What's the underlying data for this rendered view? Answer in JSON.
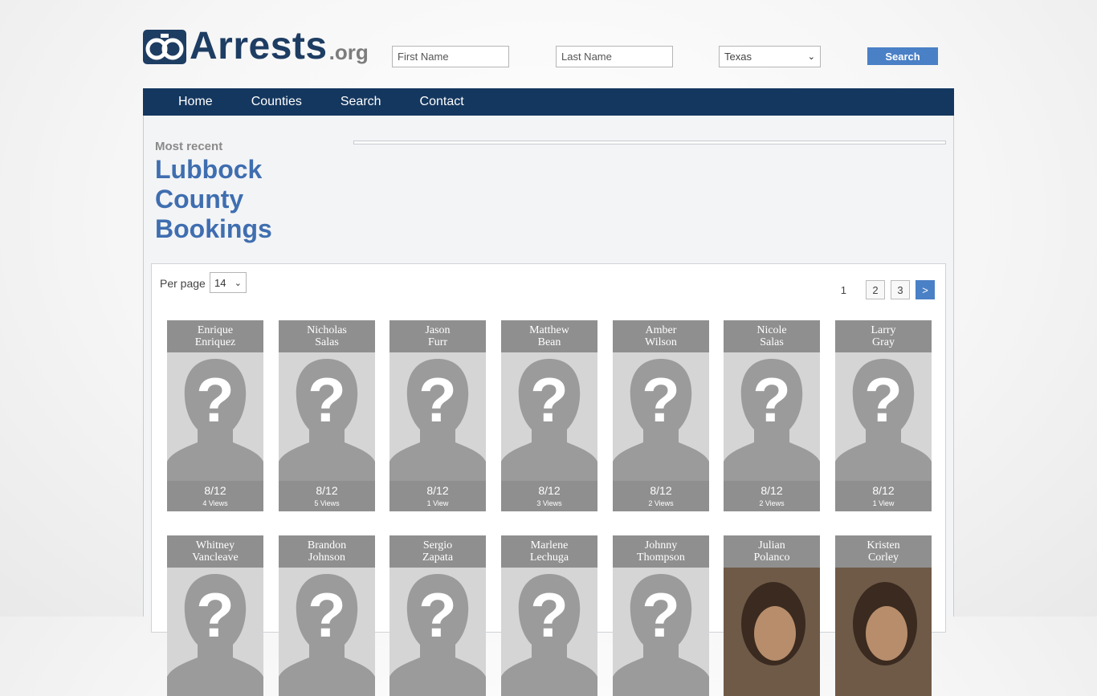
{
  "site": {
    "logo_text": "Arrests",
    "logo_suffix": ".org"
  },
  "search": {
    "first_name_placeholder": "First Name",
    "last_name_placeholder": "Last Name",
    "state_selected": "Texas",
    "button_label": "Search"
  },
  "nav": {
    "items": [
      "Home",
      "Counties",
      "Search",
      "Contact"
    ]
  },
  "page": {
    "kicker": "Most recent",
    "title": "Lubbock County Bookings"
  },
  "listing": {
    "per_page_label": "Per page",
    "per_page_value": "14",
    "pagination": {
      "current": "1",
      "pages": [
        "2",
        "3"
      ],
      "next_label": ">"
    },
    "people": [
      {
        "first": "Enrique",
        "last": "Enriquez",
        "date": "8/12",
        "views": "4 Views",
        "photo": "placeholder"
      },
      {
        "first": "Nicholas",
        "last": "Salas",
        "date": "8/12",
        "views": "5 Views",
        "photo": "placeholder"
      },
      {
        "first": "Jason",
        "last": "Furr",
        "date": "8/12",
        "views": "1 View",
        "photo": "placeholder"
      },
      {
        "first": "Matthew",
        "last": "Bean",
        "date": "8/12",
        "views": "3 Views",
        "photo": "placeholder"
      },
      {
        "first": "Amber",
        "last": "Wilson",
        "date": "8/12",
        "views": "2 Views",
        "photo": "placeholder"
      },
      {
        "first": "Nicole",
        "last": "Salas",
        "date": "8/12",
        "views": "2 Views",
        "photo": "placeholder"
      },
      {
        "first": "Larry",
        "last": "Gray",
        "date": "8/12",
        "views": "1 View",
        "photo": "placeholder"
      },
      {
        "first": "Whitney",
        "last": "Vancleave",
        "photo": "placeholder"
      },
      {
        "first": "Brandon",
        "last": "Johnson",
        "photo": "placeholder"
      },
      {
        "first": "Sergio",
        "last": "Zapata",
        "photo": "placeholder"
      },
      {
        "first": "Marlene",
        "last": "Lechuga",
        "photo": "placeholder"
      },
      {
        "first": "Johnny",
        "last": "Thompson",
        "photo": "placeholder"
      },
      {
        "first": "Julian",
        "last": "Polanco",
        "photo": "mugshot"
      },
      {
        "first": "Kristen",
        "last": "Corley",
        "photo": "mugshot"
      }
    ]
  },
  "colors": {
    "brand_navy": "#14375f",
    "accent_blue": "#4a80c6",
    "title_blue": "#3f6eb0"
  }
}
